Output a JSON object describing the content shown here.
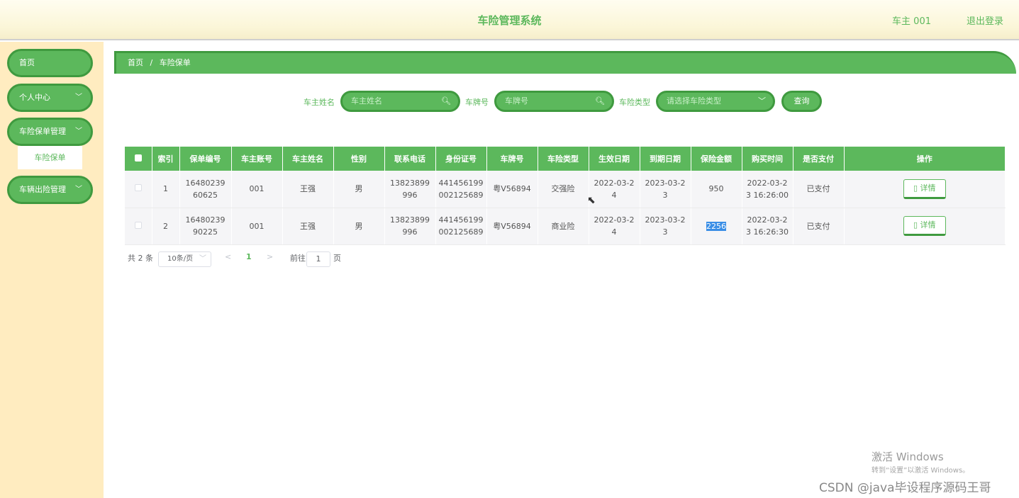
{
  "header": {
    "title": "车险管理系统",
    "user": "车主 001",
    "logout": "退出登录"
  },
  "sidebar": {
    "items": [
      {
        "label": "首页"
      },
      {
        "label": "个人中心"
      },
      {
        "label": "车险保单管理"
      },
      {
        "label": "车辆出险管理"
      }
    ],
    "sub_item": "车险保单"
  },
  "breadcrumb": {
    "home": "首页",
    "sep": "/",
    "current": "车险保单"
  },
  "search": {
    "owner_label": "车主姓名",
    "owner_placeholder": "车主姓名",
    "plate_label": "车牌号",
    "plate_placeholder": "车牌号",
    "type_label": "车险类型",
    "type_placeholder": "请选择车险类型",
    "button": "查询"
  },
  "table": {
    "headers": [
      "索引",
      "保单编号",
      "车主账号",
      "车主姓名",
      "性别",
      "联系电话",
      "身份证号",
      "车牌号",
      "车险类型",
      "生效日期",
      "到期日期",
      "保险金额",
      "购买时间",
      "是否支付",
      "操作"
    ],
    "rows": [
      {
        "index": "1",
        "policy_no": "1648023960625",
        "account": "001",
        "name": "王强",
        "gender": "男",
        "phone": "13823899996",
        "id_no": "441456199002125689",
        "plate": "粤V56894",
        "type": "交强险",
        "start": "2022-03-24",
        "end": "2023-03-23",
        "amount": "950",
        "buy_time": "2022-03-23 16:26:00",
        "paid": "已支付",
        "action": "详情"
      },
      {
        "index": "2",
        "policy_no": "1648023990225",
        "account": "001",
        "name": "王强",
        "gender": "男",
        "phone": "13823899996",
        "id_no": "441456199002125689",
        "plate": "粤V56894",
        "type": "商业险",
        "start": "2022-03-24",
        "end": "2023-03-23",
        "amount": "2256",
        "buy_time": "2022-03-23 16:26:30",
        "paid": "已支付",
        "action": "详情"
      }
    ]
  },
  "pagination": {
    "total": "共 2 条",
    "page_size": "10条/页",
    "prev": "<",
    "current": "1",
    "next": ">",
    "goto_label": "前往",
    "goto_value": "1",
    "page_suffix": "页"
  },
  "watermark": {
    "line1": "激活 Windows",
    "line2": "转到“设置”以激活 Windows。",
    "csdn": "CSDN @java毕设程序源码王哥"
  }
}
